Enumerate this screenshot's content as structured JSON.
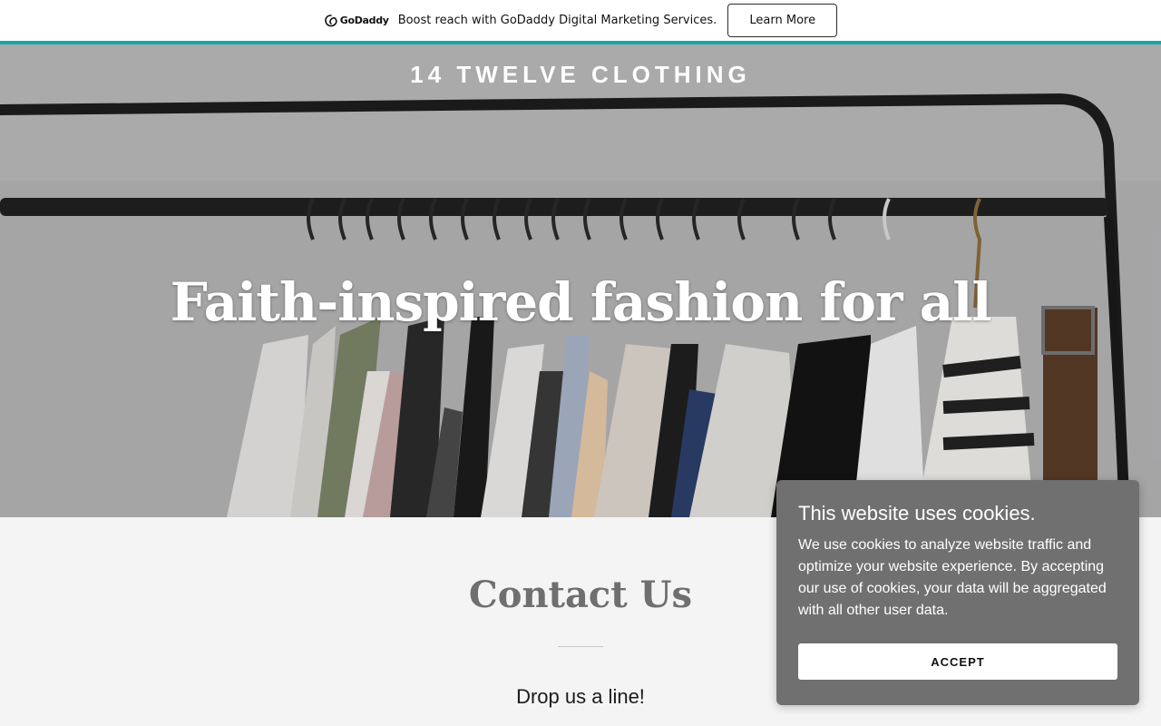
{
  "promo": {
    "logo_text": "GoDaddy",
    "message": "Boost reach with GoDaddy Digital Marketing Services.",
    "button_label": "Learn More",
    "accent_color": "#1ba6a0"
  },
  "hero": {
    "site_title": "14 TWELVE CLOTHING",
    "heading": "Faith-inspired fashion for all"
  },
  "contact": {
    "heading": "Contact Us",
    "subheading": "Drop us a line!"
  },
  "cookie": {
    "title": "This website uses cookies.",
    "body": "We use cookies to analyze website traffic and optimize your website experience. By accepting our use of cookies, your data will be aggregated with all other user data.",
    "accept_label": "ACCEPT",
    "background": "#707070"
  },
  "icons": [
    "godaddy-logo-icon"
  ]
}
